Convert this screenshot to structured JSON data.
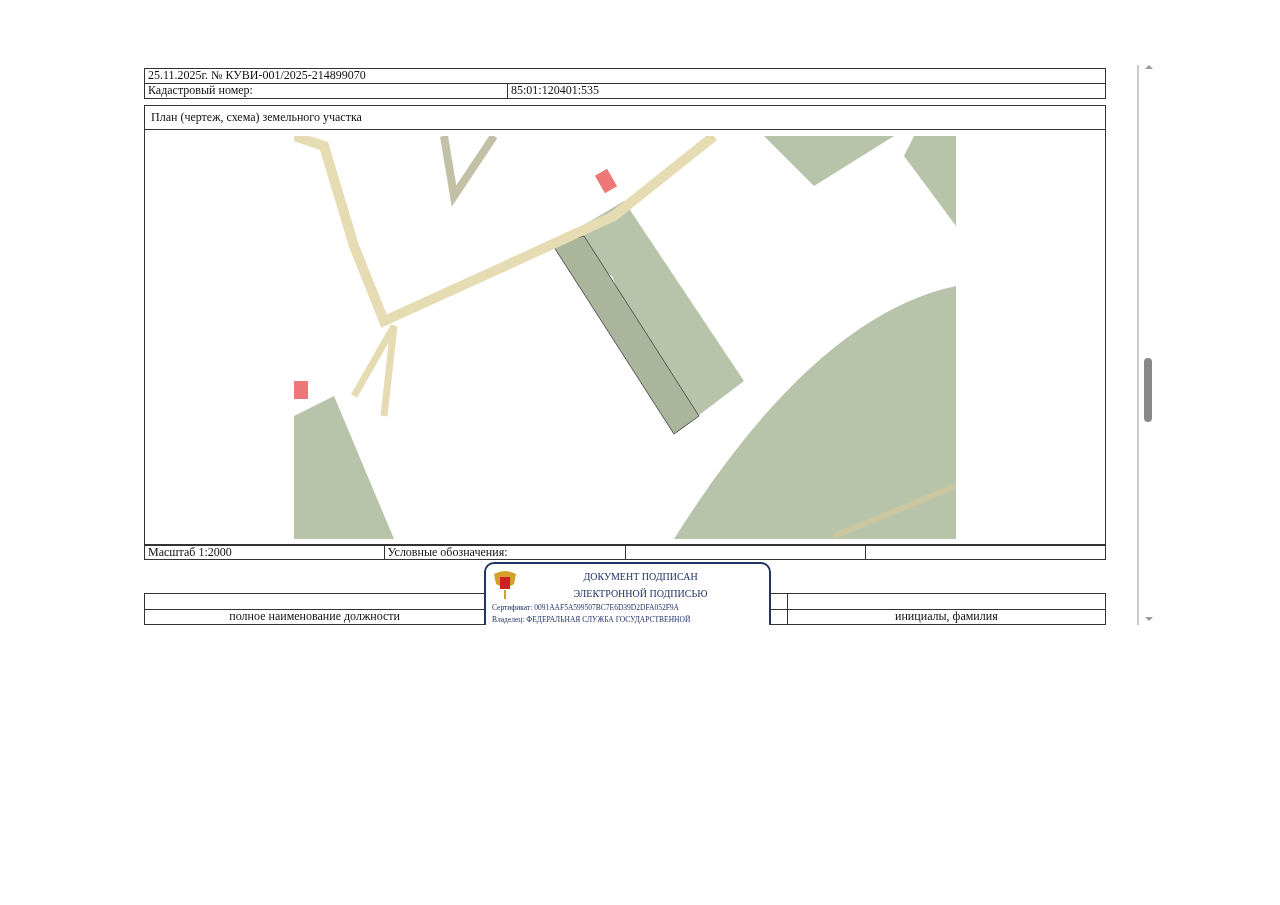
{
  "document": {
    "header": "25.11.2025г. № КУВИ-001/2025-214899070",
    "cadastral_label": "Кадастровый номер:",
    "cadastral_value": "85:01:120401:535",
    "plan_title": "План (чертеж, схема) земельного участка",
    "legend_row": [
      "Масштаб 1:2000",
      "Условные обозначения:"
    ],
    "signature_row": {
      "left": "полное наименование должности",
      "right": "инициалы, фамилия"
    },
    "stamp": {
      "lines": [
        "ДОКУМЕНТ ПОДПИСАН",
        "ЭЛЕКТРОННОЙ ПОДПИСЬЮ"
      ],
      "certificate": "Сертификат: 0091AAF5A599507BC7E6D39D2DFA052F9A",
      "owner": "Владелец: ФЕДЕРАЛЬНАЯ СЛУЖБА ГОСУДАРСТВЕННОЙ"
    }
  }
}
